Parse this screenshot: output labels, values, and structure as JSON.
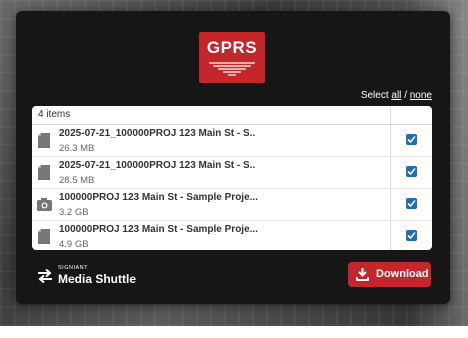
{
  "logo": {
    "text": "GPRS"
  },
  "selection": {
    "prefix": "Select",
    "all": "all",
    "separator": "/",
    "none": "none"
  },
  "list": {
    "count_label": "4 items",
    "files": [
      {
        "name": "2025-07-21_100000PROJ 123 Main St - S..",
        "size": "26.3 MB",
        "icon": "file-icon",
        "checked": true
      },
      {
        "name": "2025-07-21_100000PROJ 123 Main St - S..",
        "size": "28.5 MB",
        "icon": "file-icon",
        "checked": true
      },
      {
        "name": "100000PROJ 123 Main St - Sample Proje...",
        "size": "3.2 GB",
        "icon": "camera-icon",
        "checked": true
      },
      {
        "name": "100000PROJ 123 Main St - Sample Proje...",
        "size": "4.9 GB",
        "icon": "file-icon",
        "checked": true
      }
    ]
  },
  "brand": {
    "small": "SIGNIANT",
    "name": "Media Shuttle"
  },
  "download": {
    "label": "Download"
  },
  "colors": {
    "accent": "#c4262c",
    "checkbox": "#1f6fb2",
    "card": "#161616"
  }
}
